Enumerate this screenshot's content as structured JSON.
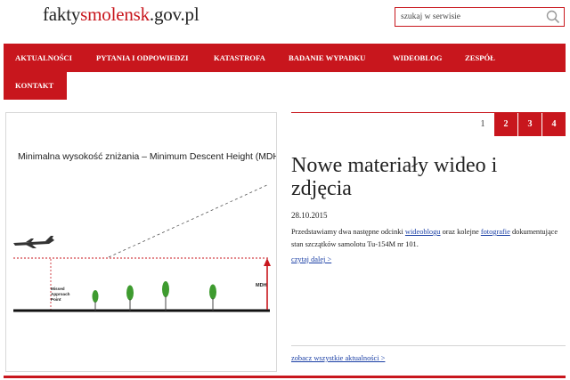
{
  "site": {
    "logo_part1": "fakty",
    "logo_part2": "smolensk",
    "logo_part3": ".gov.pl"
  },
  "search": {
    "placeholder": "szukaj w serwisie",
    "icon": "search-icon"
  },
  "nav": {
    "items": [
      "AKTUALNOŚCI",
      "PYTANIA I ODPOWIEDZI",
      "KATASTROFA",
      "BADANIE WYPADKU",
      "WIDEOBLOG",
      "ZESPÓŁ",
      "KONTAKT"
    ]
  },
  "slider": {
    "pages": [
      "1",
      "2",
      "3",
      "4"
    ],
    "active_page": "1"
  },
  "image": {
    "title": "Minimalna wysokość zniżania – Minimum Descent Height (MDH)",
    "map_label_1": "Missed",
    "map_label_2": "Approach",
    "map_label_3": "Point",
    "mdh_label": "MDH"
  },
  "article": {
    "title": "Nowe materiały wideo i zdjęcia",
    "date": "28.10.2015",
    "lead_part1": "Przedstawiamy dwa następne odcinki ",
    "lead_link1": "wideoblogu",
    "lead_part2": " oraz kolejne ",
    "lead_link2": "fotografie",
    "lead_part3": " dokumentujące stan szczątków samolotu Tu-154M nr 101.",
    "read_more": "czytaj dalej >"
  },
  "news": {
    "all_link": "zobacz wszystkie aktualności >"
  },
  "colors": {
    "brand_red": "#c8161d",
    "link_blue": "#1a3fa5"
  }
}
